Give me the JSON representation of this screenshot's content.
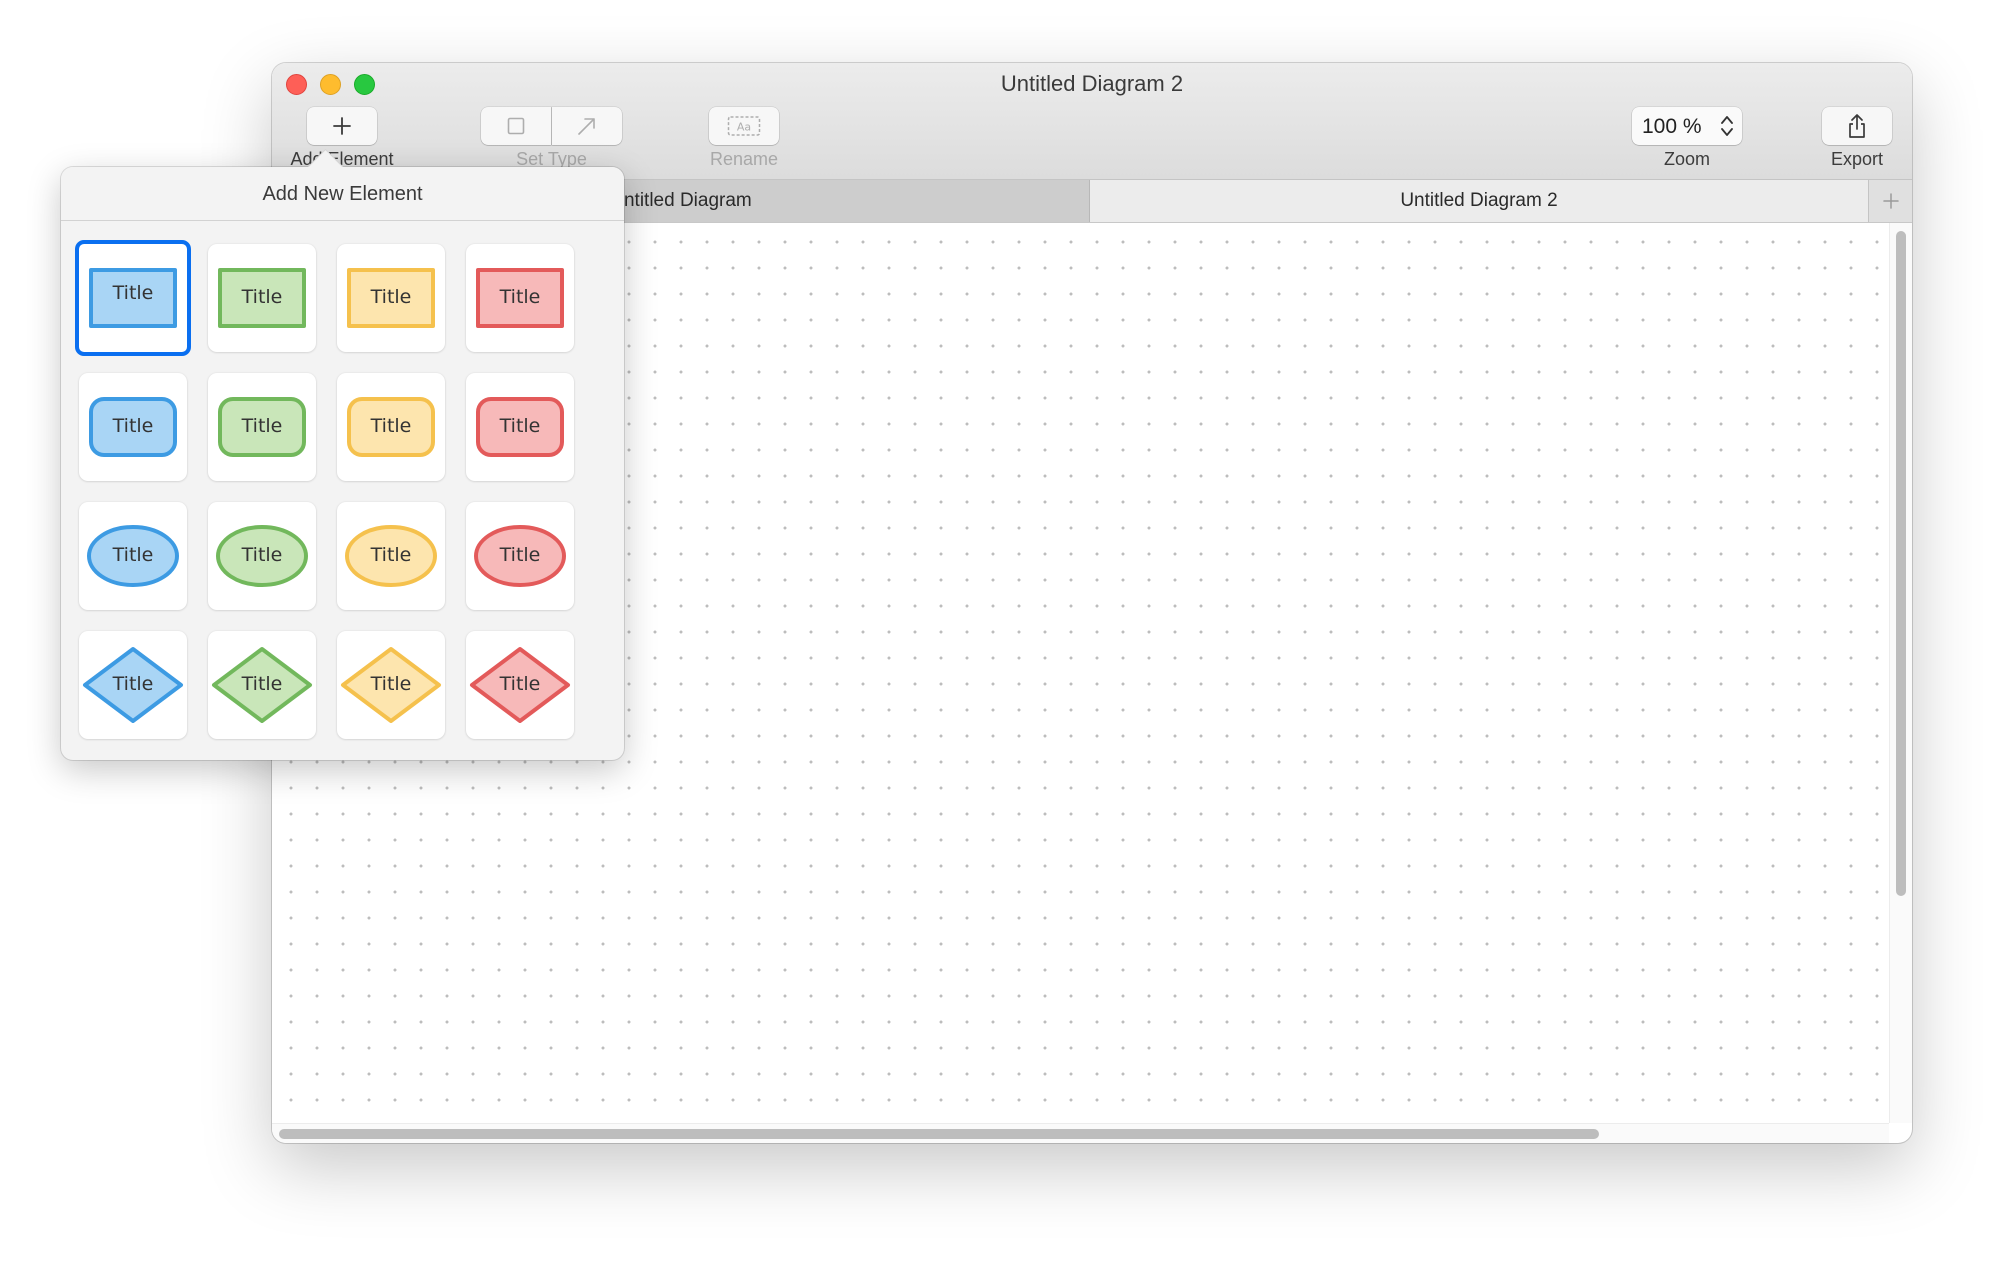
{
  "window": {
    "title": "Untitled Diagram 2",
    "traffic_lights": [
      "close",
      "minimize",
      "zoom"
    ]
  },
  "toolbar": {
    "add_element_label": "Add Element",
    "set_type_label": "Set Type",
    "rename_label": "Rename",
    "zoom_label": "Zoom",
    "zoom_value": "100 %",
    "export_label": "Export"
  },
  "tabs": [
    {
      "label": "Untitled Diagram",
      "active": false
    },
    {
      "label": "Untitled Diagram 2",
      "active": true
    }
  ],
  "popover": {
    "title": "Add New Element",
    "selected_index": 0,
    "shape_rows": [
      "rectangle",
      "rounded-rectangle",
      "ellipse",
      "diamond"
    ],
    "color_columns": [
      {
        "name": "blue",
        "fill": "#a9d5f5",
        "stroke": "#3d9be3"
      },
      {
        "name": "green",
        "fill": "#c9e6b9",
        "stroke": "#72b85c"
      },
      {
        "name": "yellow",
        "fill": "#fde5ae",
        "stroke": "#f5c14d"
      },
      {
        "name": "red",
        "fill": "#f7b9b9",
        "stroke": "#e35a5a"
      }
    ],
    "shape_label": "Title"
  },
  "colors": {
    "selection": "#0a6ff0",
    "canvas_dot": "#bdbdbd"
  }
}
